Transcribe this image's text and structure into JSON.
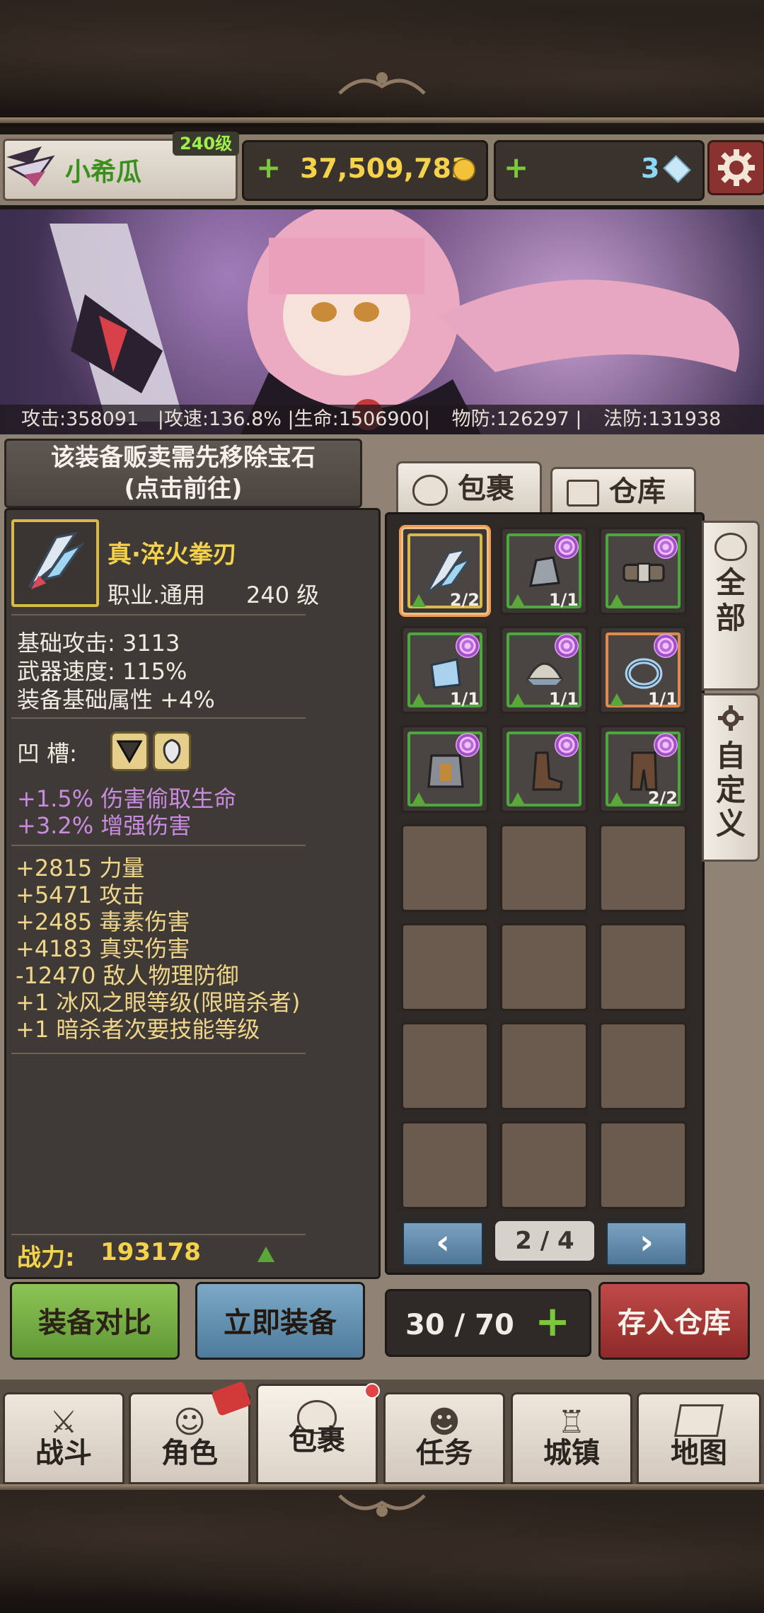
{
  "header": {
    "player_name": "小希瓜",
    "level": "240级",
    "gold": "37,509,783",
    "gems": "3"
  },
  "stats": {
    "attack": "攻击:358091",
    "attack_speed": "|攻速:136.8%",
    "hp": "|生命:1506900|",
    "phys_def": "物防:126297 |",
    "magic_def": "法防:131938"
  },
  "notice": {
    "line1": "该装备贩卖需先移除宝石",
    "line2": "(点击前往)"
  },
  "item": {
    "name": "真·淬火拳刃",
    "class": "职业.通用",
    "level": "240 级",
    "base_attack": "基础攻击:  3113",
    "weapon_speed": "武器速度:  115%",
    "base_attr": "装备基础属性 +4%",
    "socket_label": "凹   槽:",
    "gem_effects": [
      "+1.5% 伤害偷取生命",
      "+3.2% 增强伤害"
    ],
    "bonuses": [
      "+2815 力量",
      "+5471 攻击",
      "+2485 毒素伤害",
      "+4183 真实伤害",
      "-12470 敌人物理防御",
      "+1 冰风之眼等级(限暗杀者)",
      "+1 暗杀者次要技能等级"
    ],
    "power_label": "战力:",
    "power": "193178"
  },
  "inventory": {
    "tab_bag": "包裹",
    "tab_warehouse": "仓库",
    "side_all": "全部",
    "side_custom": "自定义",
    "page": "2 / 4",
    "capacity": "30 / 70",
    "slots": [
      {
        "icon": "claw-blade-icon",
        "count": "2/2"
      },
      {
        "icon": "gauntlet-icon",
        "count": "1/1"
      },
      {
        "icon": "belt-icon",
        "count": ""
      },
      {
        "icon": "bracer-icon",
        "count": "1/1"
      },
      {
        "icon": "helmet-icon",
        "count": "1/1"
      },
      {
        "icon": "ring-icon",
        "count": "1/1"
      },
      {
        "icon": "armor-icon",
        "count": ""
      },
      {
        "icon": "boots-icon",
        "count": ""
      },
      {
        "icon": "leg-armor-icon",
        "count": "2/2"
      }
    ]
  },
  "actions": {
    "compare": "装备对比",
    "equip": "立即装备",
    "store": "存入仓库"
  },
  "nav": {
    "battle": "战斗",
    "character": "角色",
    "bag": "包裹",
    "quest": "任务",
    "town": "城镇",
    "map": "地图"
  },
  "colors": {
    "gold": "#f5d24b",
    "green_border": "#4ca83b",
    "purple_text": "#c98be0",
    "accent_red": "#8e2a29"
  }
}
